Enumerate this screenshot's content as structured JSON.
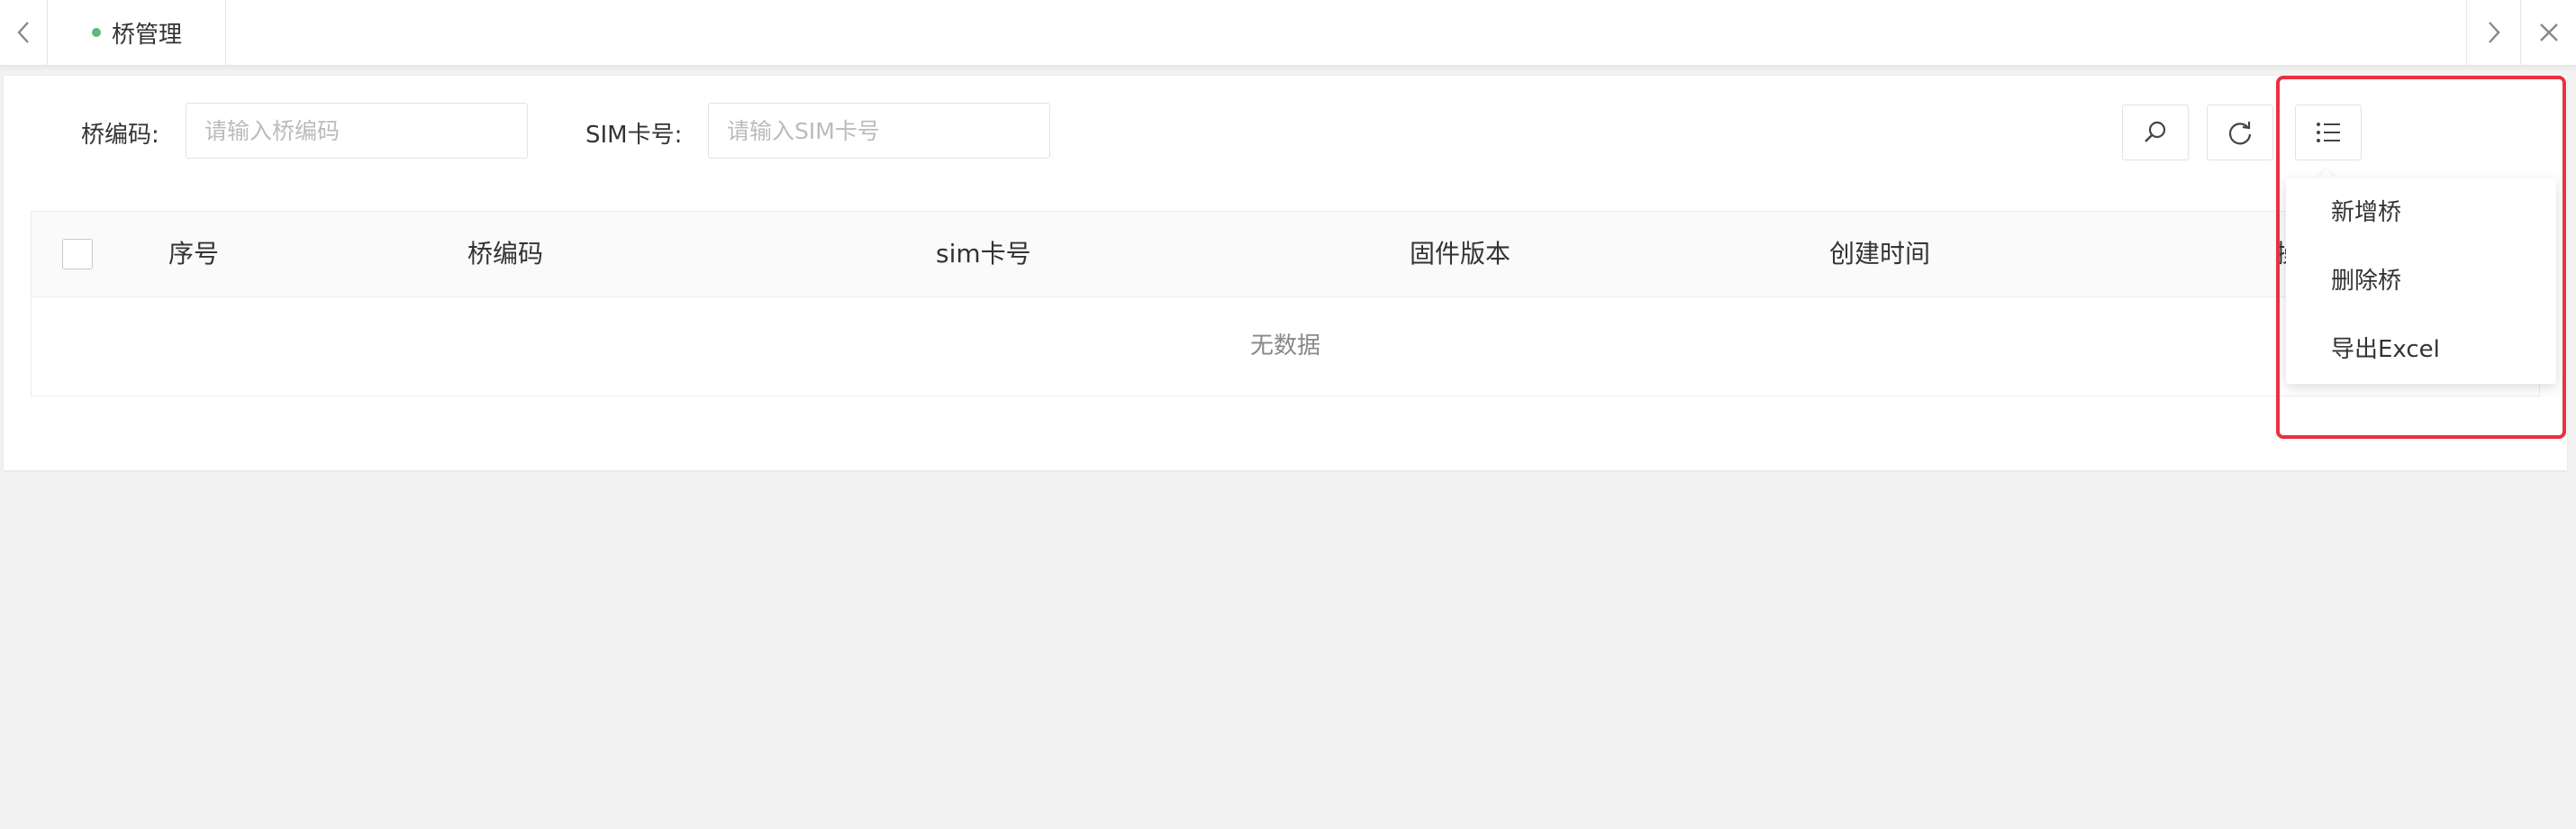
{
  "tabs": {
    "active_label": "桥管理",
    "prev_icon": "chevron-left-icon",
    "next_icon": "chevron-right-icon",
    "close_icon": "close-icon",
    "active_dot_color": "#5fb878"
  },
  "filters": {
    "bridge_code_label": "桥编码:",
    "bridge_code_placeholder": "请输入桥编码",
    "sim_label": "SIM卡号:",
    "sim_placeholder": "请输入SIM卡号"
  },
  "toolbar": {
    "search_icon": "search-icon",
    "refresh_icon": "refresh-icon",
    "menu_icon": "list-menu-icon"
  },
  "table": {
    "columns": [
      "序号",
      "桥编码",
      "sim卡号",
      "固件版本",
      "创建时间",
      "操"
    ],
    "empty_text": "无数据"
  },
  "dropdown": {
    "items": [
      "新增桥",
      "删除桥",
      "导出Excel"
    ]
  },
  "annotation": {
    "highlight_color": "#e8323f"
  }
}
